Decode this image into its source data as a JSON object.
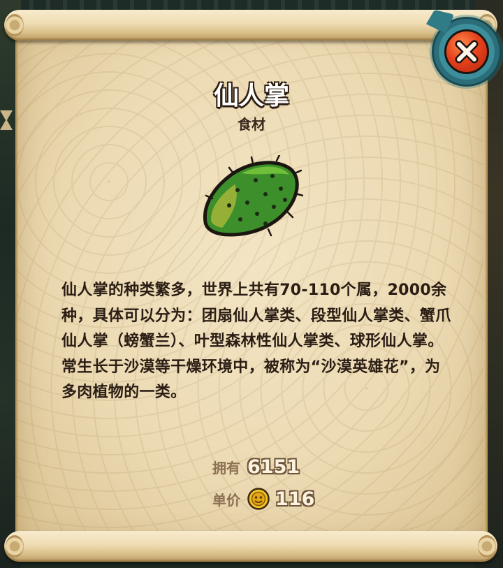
{
  "item": {
    "name": "仙人掌",
    "category": "食材",
    "description": "仙人掌的种类繁多，世界上共有70-110个属，2000余种，具体可以分为：团扇仙人掌类、段型仙人掌类、蟹爪仙人掌（螃蟹兰）、叶型森林性仙人掌类、球形仙人掌。常生长于沙漠等干燥环境中，被称为“沙漠英雄花”，为多肉植物的一类。",
    "image_icon": "cactus-pad-icon"
  },
  "stats": {
    "owned_label": "拥有",
    "owned_value": "6151",
    "price_label": "单价",
    "price_value": "116",
    "price_icon": "gold-coin-icon"
  },
  "close_button": {
    "icon": "close-icon",
    "color": "#e5421c"
  },
  "colors": {
    "paper": "#ecdab3",
    "title_text": "#ffffff",
    "body_text": "#2a1d14",
    "stat_label": "#8c7153",
    "frame_teal": "#3b8e9a"
  }
}
